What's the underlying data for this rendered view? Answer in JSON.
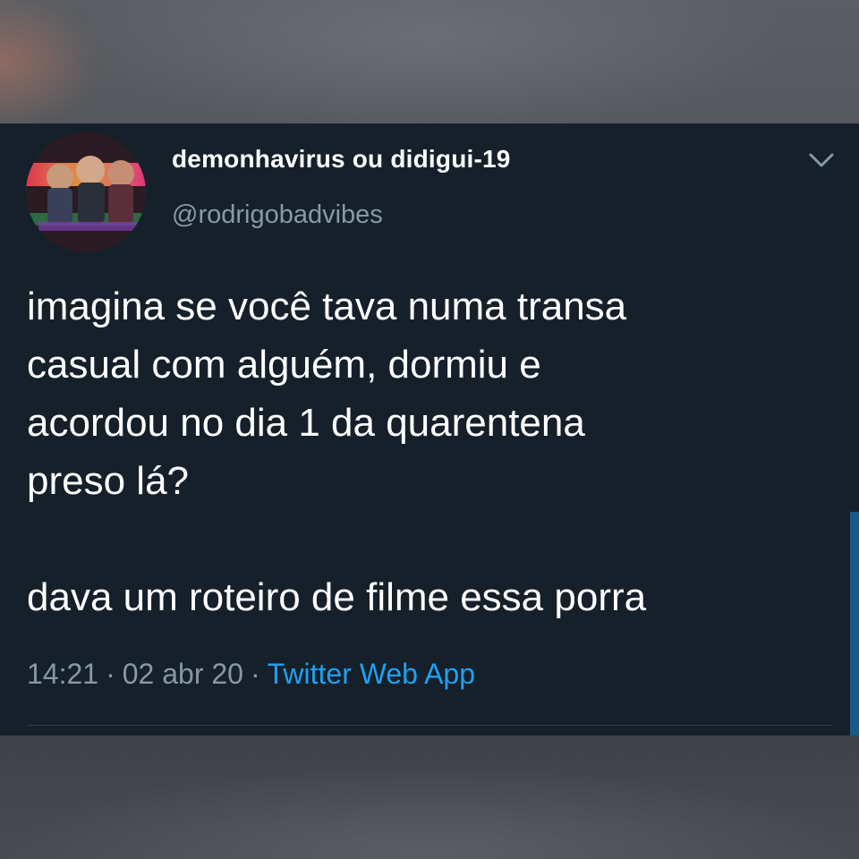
{
  "tweet": {
    "author": {
      "display_name": "demonhavirus ou didigui-19",
      "handle": "@rodrigobadvibes"
    },
    "text_lines_1": [
      "imagina se você tava numa transa",
      "casual com alguém, dormiu e",
      "acordou no dia 1 da quarentena",
      "preso lá?"
    ],
    "text_line_2": "dava um roteiro de filme essa porra",
    "time": "14:21",
    "separator": "·",
    "date": "02 abr 20",
    "source": "Twitter Web App",
    "menu_icon": "chevron-down-icon"
  },
  "colors": {
    "card_background": "#15202b",
    "text_primary": "#ffffff",
    "text_secondary": "#8899a6",
    "link": "#1da1f2"
  }
}
